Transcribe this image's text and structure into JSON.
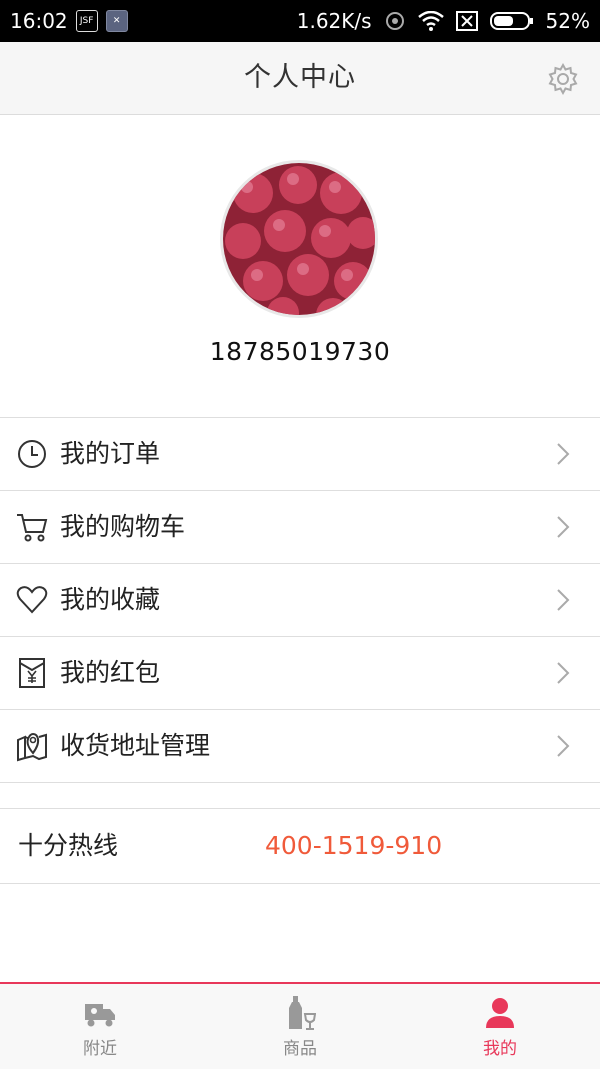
{
  "status_bar": {
    "time": "16:02",
    "badge1": "JSF",
    "badge2": "✕",
    "speed": "1.62K/s",
    "battery": "52%"
  },
  "header": {
    "title": "个人中心",
    "settings_icon": "gear-icon"
  },
  "profile": {
    "phone": "18785019730"
  },
  "menu": {
    "items": [
      {
        "label": "我的订单",
        "icon": "clock-icon"
      },
      {
        "label": "我的购物车",
        "icon": "cart-icon"
      },
      {
        "label": "我的收藏",
        "icon": "heart-icon"
      },
      {
        "label": "我的红包",
        "icon": "red-envelope-icon"
      },
      {
        "label": "收货地址管理",
        "icon": "map-pin-icon"
      }
    ]
  },
  "hotline": {
    "label": "十分热线",
    "number": "400-1519-910"
  },
  "tabbar": {
    "tabs": [
      {
        "label": "附近",
        "icon": "delivery-truck-icon",
        "active": false
      },
      {
        "label": "商品",
        "icon": "bottle-glass-icon",
        "active": false
      },
      {
        "label": "我的",
        "icon": "user-icon",
        "active": true
      }
    ]
  },
  "colors": {
    "accent": "#e8385a",
    "hotline_number": "#f05a3a"
  }
}
